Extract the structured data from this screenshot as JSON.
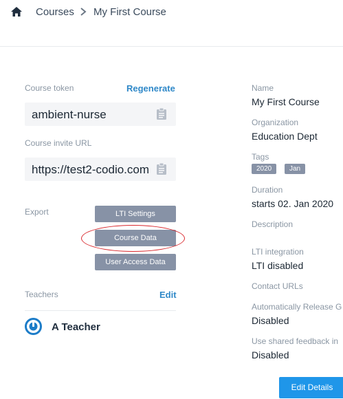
{
  "breadcrumb": {
    "home_icon": "home-icon",
    "courses": "Courses",
    "separator_icon": "chevron-right-icon",
    "current": "My First Course"
  },
  "token": {
    "label": "Course token",
    "regenerate": "Regenerate",
    "value": "ambient-nurse",
    "copy_icon": "clipboard-icon"
  },
  "invite": {
    "label": "Course invite URL",
    "value": "https://test2-codio.com",
    "copy_icon": "clipboard-icon"
  },
  "export": {
    "label": "Export",
    "buttons": [
      "LTI Settings",
      "Course Data",
      "User Access Data"
    ],
    "highlighted": "Course Data",
    "highlight_color": "#d9262b"
  },
  "teachers": {
    "label": "Teachers",
    "edit": "Edit",
    "list": [
      {
        "name": "A Teacher",
        "icon": "teacher-avatar-icon"
      }
    ]
  },
  "details": {
    "name_label": "Name",
    "name": "My First Course",
    "org_label": "Organization",
    "org": "Education Dept",
    "tags_label": "Tags",
    "tags": [
      "2020",
      "Jan"
    ],
    "duration_label": "Duration",
    "duration": "starts 02. Jan 2020",
    "description_label": "Description",
    "lti_label": "LTI integration",
    "lti": "LTI disabled",
    "contact_label": "Contact URLs",
    "auto_release_label": "Automatically Release G",
    "auto_release": "Disabled",
    "shared_feedback_label": "Use shared feedback in",
    "shared_feedback": "Disabled",
    "edit_button": "Edit Details"
  },
  "colors": {
    "accent_link": "#2f88c8",
    "primary_button": "#1f96e9",
    "secondary_button": "#8792a6"
  }
}
